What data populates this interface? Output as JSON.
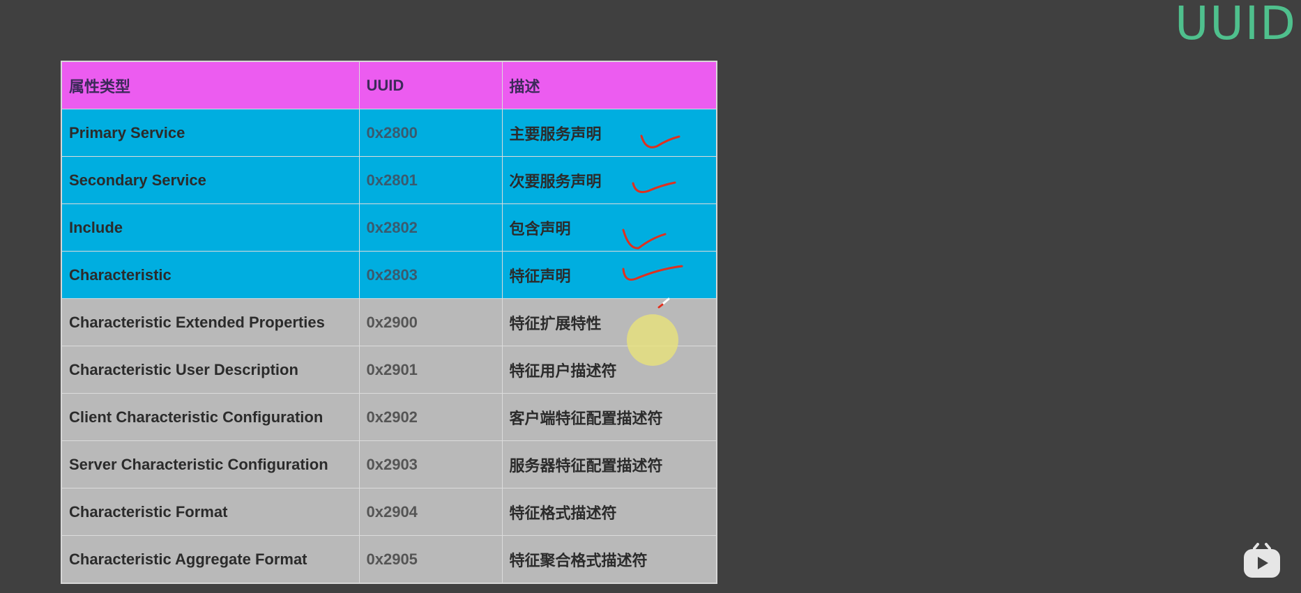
{
  "slide": {
    "title": "UUID"
  },
  "table": {
    "headers": [
      "属性类型",
      "UUID",
      "描述"
    ],
    "rows": [
      {
        "type": "Primary Service",
        "uuid": "0x2800",
        "desc": "主要服务声明",
        "highlight": true
      },
      {
        "type": "Secondary Service",
        "uuid": "0x2801",
        "desc": "次要服务声明",
        "highlight": true
      },
      {
        "type": "Include",
        "uuid": "0x2802",
        "desc": "包含声明",
        "highlight": true
      },
      {
        "type": "Characteristic",
        "uuid": "0x2803",
        "desc": "特征声明",
        "highlight": true
      },
      {
        "type": "Characteristic Extended Properties",
        "uuid": "0x2900",
        "desc": "特征扩展特性",
        "highlight": false
      },
      {
        "type": "Characteristic User Description",
        "uuid": "0x2901",
        "desc": "特征用户描述符",
        "highlight": false
      },
      {
        "type": "Client Characteristic Configuration",
        "uuid": "0x2902",
        "desc": "客户端特征配置描述符",
        "highlight": false
      },
      {
        "type": "Server Characteristic Configuration",
        "uuid": "0x2903",
        "desc": "服务器特征配置描述符",
        "highlight": false
      },
      {
        "type": "Characteristic Format",
        "uuid": "0x2904",
        "desc": "特征格式描述符",
        "highlight": false
      },
      {
        "type": "Characteristic Aggregate Format",
        "uuid": "0x2905",
        "desc": "特征聚合格式描述符",
        "highlight": false
      }
    ]
  },
  "colors": {
    "background": "#404040",
    "title": "#4fc08d",
    "header": "#ec5cf0",
    "highlight_row": "#00aee0",
    "normal_row": "#b9b9b9",
    "annotation": "#e0301e",
    "cursor_halo": "#e9e27a"
  },
  "icons": {
    "annotation_marks": "checkmark-icon",
    "pointer": "pen-cursor-icon",
    "player": "bilibili-tv-icon"
  }
}
